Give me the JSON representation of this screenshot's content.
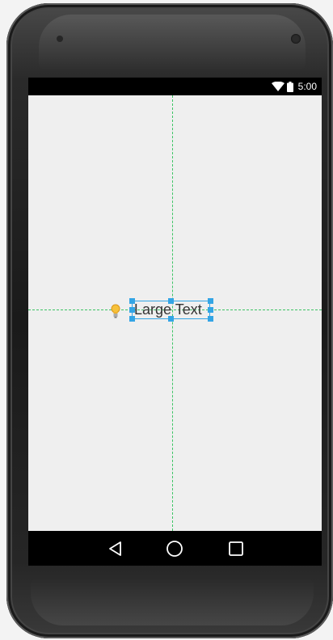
{
  "status_bar": {
    "time": "5:00",
    "wifi_icon": "wifi-icon",
    "battery_icon": "battery-icon"
  },
  "layout_editor": {
    "textview_label": "Large Text",
    "hint_icon": "lightbulb-icon",
    "guide_color": "#3cc464",
    "selection_color": "#33a5e5"
  },
  "nav_bar": {
    "back_icon": "back-triangle-icon",
    "home_icon": "home-circle-icon",
    "recents_icon": "recents-square-icon"
  }
}
